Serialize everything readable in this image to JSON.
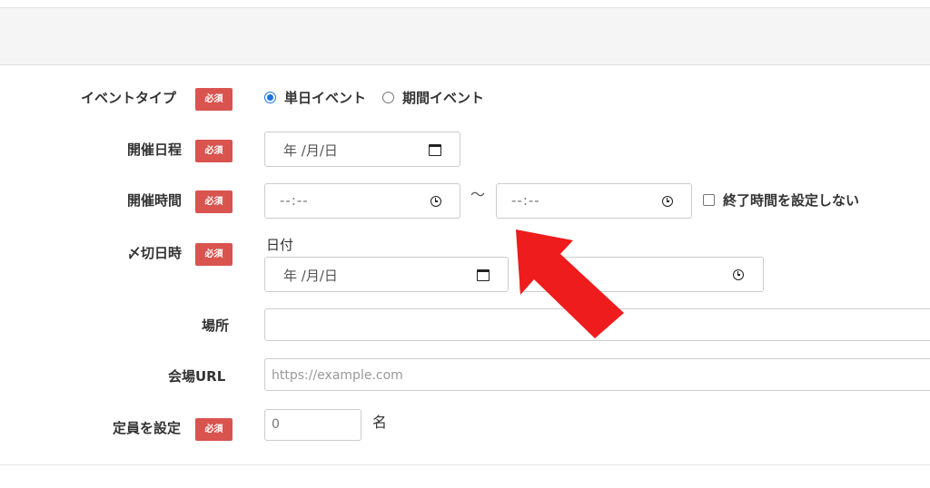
{
  "required_badge": "必須",
  "event_type": {
    "label": "イベントタイプ",
    "options": [
      {
        "label": "単日イベント",
        "selected": true
      },
      {
        "label": "期間イベント",
        "selected": false
      }
    ]
  },
  "event_date": {
    "label": "開催日程",
    "value": "年 /月/日"
  },
  "event_time": {
    "label": "開催時間",
    "start": "--:--",
    "separator": "〜",
    "end": "--:--",
    "no_end_time_label": "終了時間を設定しない",
    "no_end_time_checked": false
  },
  "deadline": {
    "label": "〆切日時",
    "sublabel": "日付",
    "date_value": "年 /月/日"
  },
  "venue": {
    "label": "場所",
    "value": ""
  },
  "venue_url": {
    "label": "会場URL",
    "placeholder": "https://example.com"
  },
  "capacity": {
    "label": "定員を設定",
    "placeholder": "0",
    "unit": "名"
  },
  "colors": {
    "badge": "#d9534f",
    "radio_accent": "#1a73e8",
    "annotation_arrow": "#ee1c1c"
  },
  "icons": [
    "calendar-icon",
    "clock-icon"
  ]
}
